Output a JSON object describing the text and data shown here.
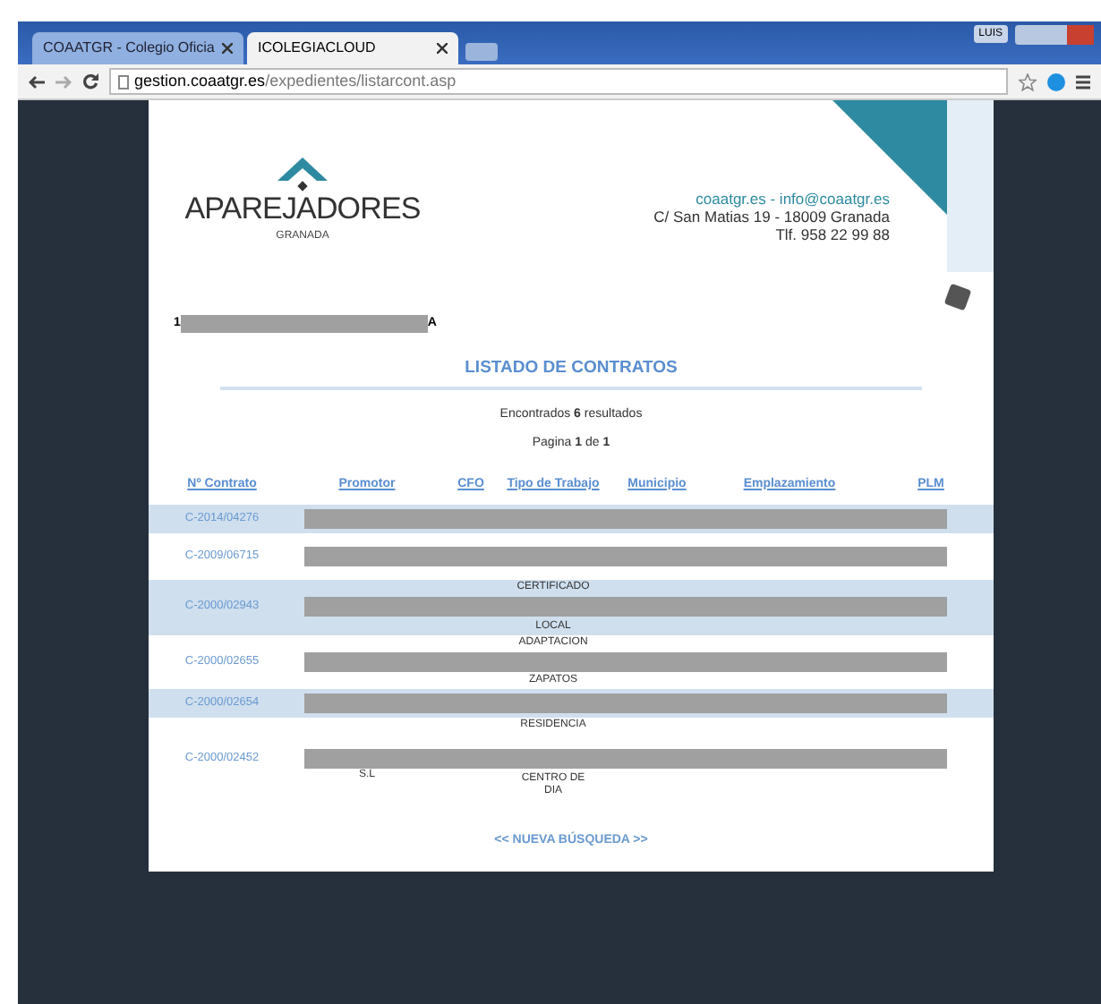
{
  "browser": {
    "tabs": [
      {
        "title": "COAATGR - Colegio Oficia",
        "selected": false
      },
      {
        "title": "ICOLEGIACLOUD",
        "selected": true
      }
    ],
    "user_badge": "LUIS",
    "address": {
      "host": "gestion.coaatgr.es",
      "path": "/expedientes/listarcont.asp"
    }
  },
  "header": {
    "logo_title": "APAREJADORES",
    "logo_subtitle": "GRANADA",
    "web_contact": "coaatgr.es - info@coaatgr.es",
    "address": "C/ San Matias 19 - 18009 Granada",
    "phone": "Tlf. 958 22 99 88"
  },
  "user_line": {
    "start": "1",
    "end": "A"
  },
  "title": "LISTADO DE CONTRATOS",
  "summary": "Encontrados **6** resultados",
  "pagination": "Pagina **1** de **1**",
  "table": {
    "columns": [
      "Nº Contrato",
      "Promotor",
      "CFO",
      "Tipo de Trabajo",
      "Municipio",
      "Emplazamiento",
      "PLM"
    ],
    "rows": [
      {
        "contract": "C-2014/04276",
        "above": [],
        "below": [],
        "promotor_below": ""
      },
      {
        "contract": "C-2009/06715",
        "above": [],
        "below": [],
        "promotor_below": ""
      },
      {
        "contract": "C-2000/02943",
        "above": [
          "CERTIFICADO"
        ],
        "below": [
          "LOCAL"
        ],
        "promotor_below": ""
      },
      {
        "contract": "C-2000/02655",
        "above": [
          "ADAPTACION"
        ],
        "below": [
          "ZAPATOS"
        ],
        "promotor_below": ""
      },
      {
        "contract": "C-2000/02654",
        "above": [],
        "below": [],
        "promotor_below": ""
      },
      {
        "contract": "C-2000/02452",
        "above": [
          "RESIDENCIA"
        ],
        "below": [
          "CENTRO DE",
          "DIA"
        ],
        "promotor_below": "S.L"
      }
    ]
  },
  "footer_link": "<< NUEVA BÚSQUEDA >>"
}
